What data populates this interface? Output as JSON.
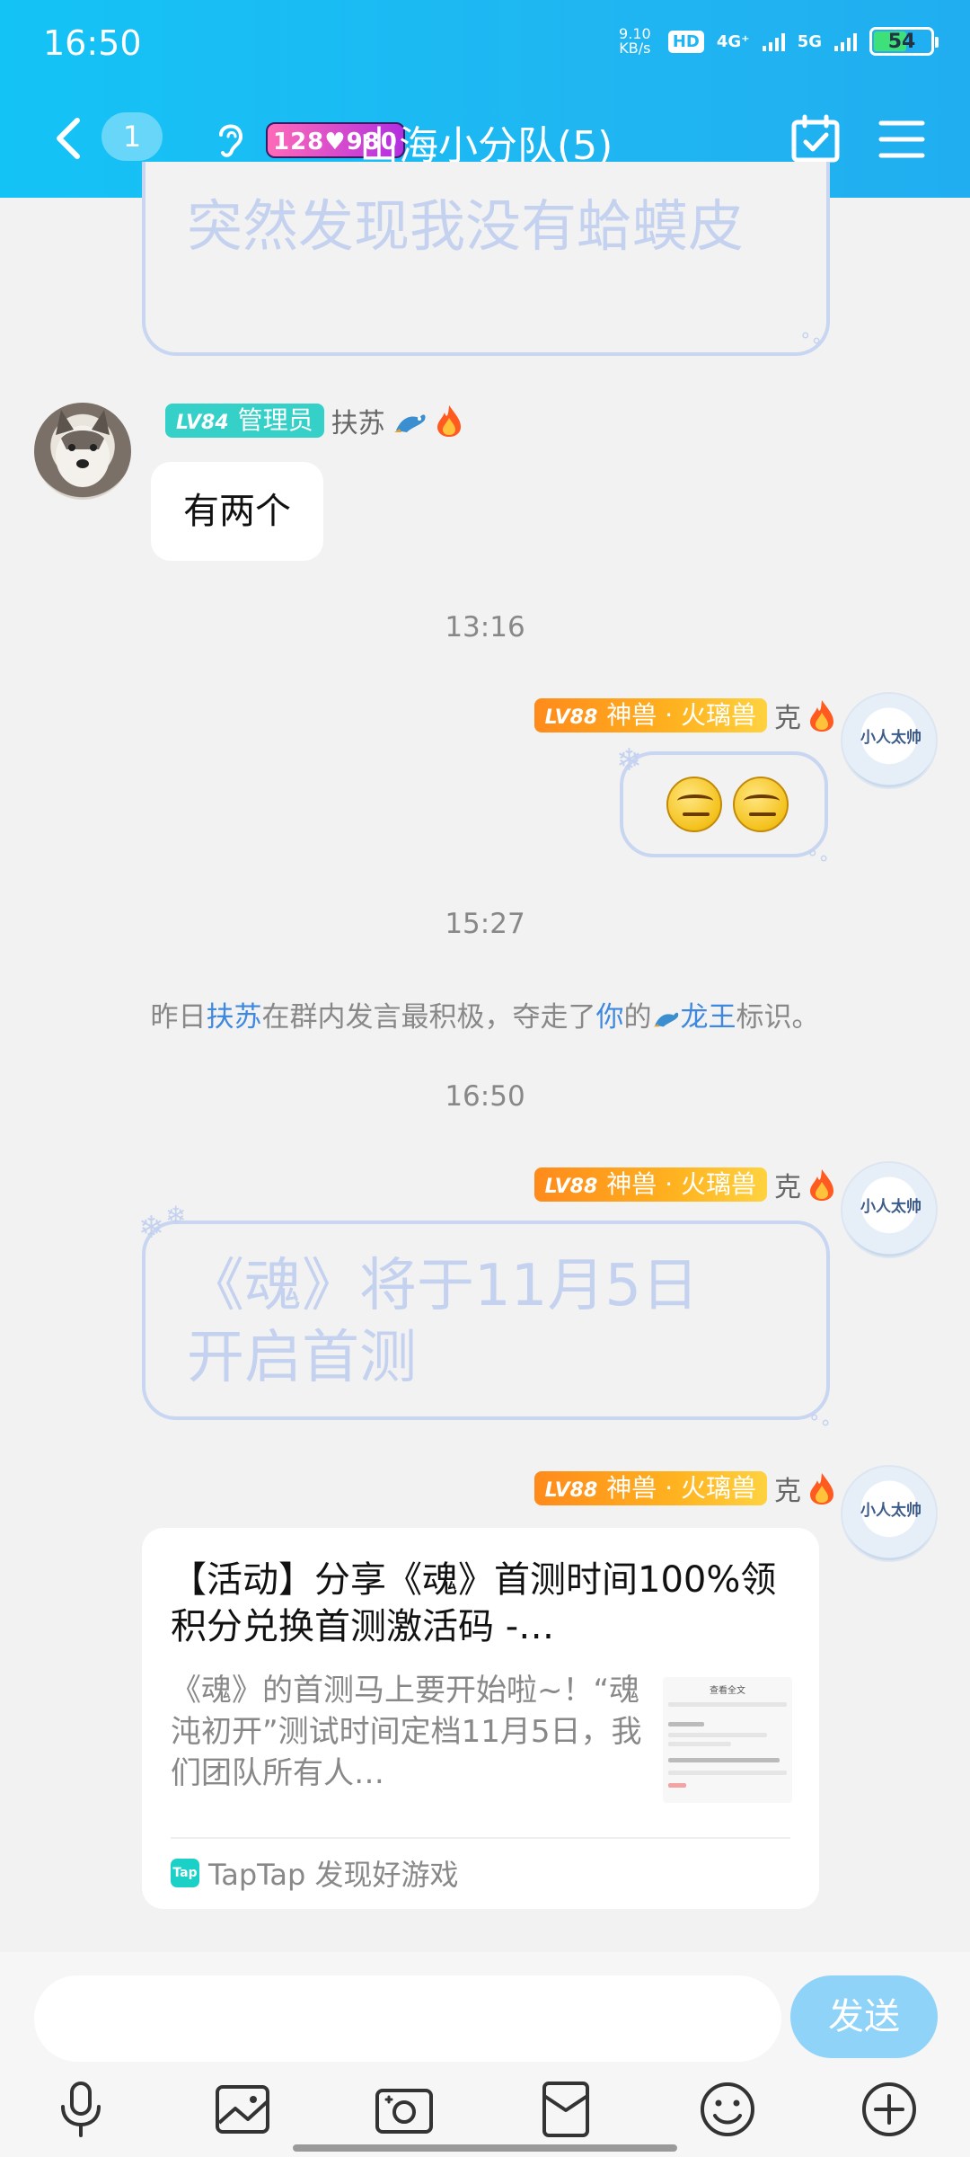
{
  "status_bar": {
    "time": "16:50",
    "net_speed_value": "9.10",
    "net_speed_unit": "KB/s",
    "hd": "HD",
    "sim1": "4G⁺",
    "sim2": "5G",
    "battery": "54"
  },
  "header": {
    "unread_count": "1",
    "group_badge": "128♥980",
    "title": "山海小分队(5)",
    "icons": [
      "back-arrow-icon",
      "ear-icon",
      "calendar-check-icon",
      "menu-icon"
    ]
  },
  "messages": {
    "top_partial_text": "突然发现我没有蛤蟆皮",
    "msg1": {
      "badge_level": "LV84",
      "badge_title": "管理员",
      "nickname": "扶苏",
      "text": "有两个"
    },
    "ts1": "13:16",
    "msg2": {
      "badge_level": "LV88",
      "badge_title": "神兽 · 火璃兽",
      "nickname": "克",
      "avatar_text": "小人太帅"
    },
    "ts2": "15:27",
    "system": {
      "p1": "昨日",
      "name": "扶苏",
      "p2": "在群内发言最积极，夺走了",
      "you": "你",
      "p3": "的",
      "title": "龙王",
      "p4": "标识。"
    },
    "ts3": "16:50",
    "msg3": {
      "badge_level": "LV88",
      "badge_title": "神兽 · 火璃兽",
      "nickname": "克",
      "line1": "《魂》将于11月5日",
      "line2": "开启首测"
    },
    "msg4": {
      "badge_level": "LV88",
      "badge_title": "神兽 · 火璃兽",
      "nickname": "克",
      "card_title": "【活动】分享《魂》首测时间100%领积分兑换首测激活码 -…",
      "card_desc": "《魂》的首测马上要开始啦~！“魂沌初开”测试时间定档11月5日，我们团队所有人…",
      "card_source": "TapTap 发现好游戏",
      "thumb_title": "查看全文"
    }
  },
  "input": {
    "placeholder": "",
    "send_label": "发送"
  },
  "toolbar": [
    "microphone-icon",
    "image-icon",
    "camera-icon",
    "red-packet-icon",
    "emoji-icon",
    "plus-icon"
  ],
  "colors": {
    "header_start": "#14c3f6",
    "header_end": "#20aef0",
    "admin_badge": "#35d0c7",
    "beast_badge_start": "#ff8a1b",
    "beast_badge_end": "#ffd240",
    "link": "#3f88e0",
    "send_button": "#8fd3f8"
  }
}
